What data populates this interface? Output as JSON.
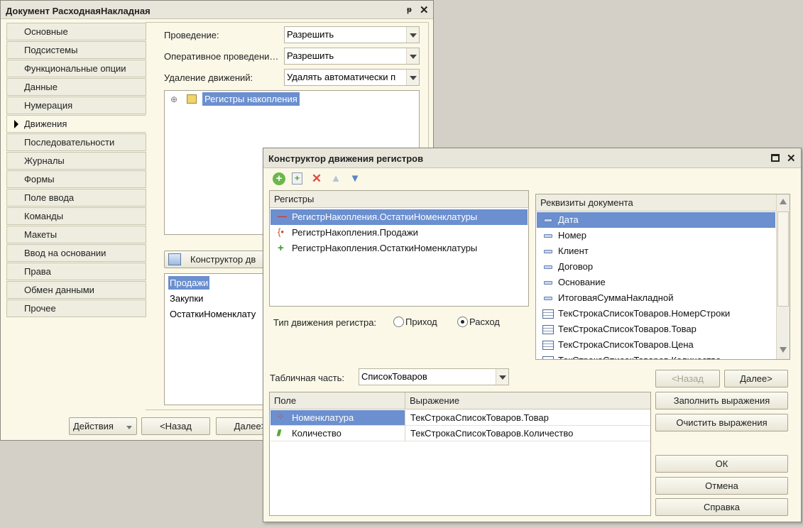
{
  "doc_window": {
    "title": "Документ РасходнаяНакладная",
    "pin_icon": "pin-icon",
    "tabs": [
      "Основные",
      "Подсистемы",
      "Функциональные опции",
      "Данные",
      "Нумерация",
      "Движения",
      "Последовательности",
      "Журналы",
      "Формы",
      "Поле ввода",
      "Команды",
      "Макеты",
      "Ввод на основании",
      "Права",
      "Обмен данными",
      "Прочее"
    ],
    "selected_tab": "Движения",
    "fields": {
      "posting_label": "Проведение:",
      "posting_value": "Разрешить",
      "realtime_label": "Оперативное проведени…",
      "realtime_value": "Разрешить",
      "delete_label": "Удаление движений:",
      "delete_value": "Удалять автоматически п"
    },
    "tree_item": "Регистры накопления",
    "constructor_button": "Конструктор дв",
    "registers_list": [
      "Продажи",
      "Закупки",
      "ОстаткиНоменклату"
    ],
    "actions_button": "Действия",
    "back_button": "<Назад",
    "next_button": "Далее>"
  },
  "ctor_window": {
    "title": "Конструктор движения регистров",
    "registers_header": "Регистры",
    "registers": [
      {
        "name": "РегистрНакопления.ОстаткиНоменклатуры",
        "icon": "minus-icon"
      },
      {
        "name": "РегистрНакопления.Продажи",
        "icon": "brace-icon"
      },
      {
        "name": "РегистрНакопления.ОстаткиНоменклатуры",
        "icon": "plus-icon"
      }
    ],
    "attrs_header": "Реквизиты документа",
    "attributes": [
      "Дата",
      "Номер",
      "Клиент",
      "Договор",
      "Основание",
      "ИтоговаяСуммаНакладной",
      "ТекСтрокаСписокТоваров.НомерСтроки",
      "ТекСтрокаСписокТоваров.Товар",
      "ТекСтрокаСписокТоваров.Цена",
      "ТекСтрокаСписокТоваров.Количество"
    ],
    "movement_type_label": "Тип движения регистра:",
    "income_label": "Приход",
    "expense_label": "Расход",
    "tabular_label": "Табличная часть:",
    "tabular_value": "СписокТоваров",
    "back_button": "<Назад",
    "next_button": "Далее>",
    "field_header": "Поле",
    "expr_header": "Выражение",
    "mappings": [
      {
        "field": "Номенклатура",
        "expr": "ТекСтрокаСписокТоваров.Товар"
      },
      {
        "field": "Количество",
        "expr": "ТекСтрокаСписокТоваров.Количество"
      }
    ],
    "fill_button": "Заполнить выражения",
    "clear_button": "Очистить выражения",
    "ok_button": "ОК",
    "cancel_button": "Отмена",
    "help_button": "Справка"
  }
}
